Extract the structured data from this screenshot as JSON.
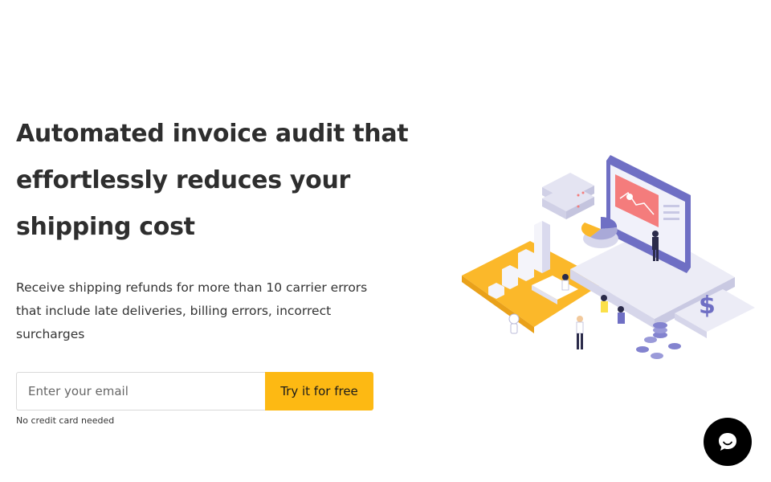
{
  "hero": {
    "title_lines": [
      "Automated invoice audit that",
      "effortlessly reduces your",
      "shipping cost"
    ],
    "subtitle_lines": [
      "Receive shipping refunds for more than 10 carrier errors",
      "that include late deliveries, billing errors, incorrect",
      "surcharges"
    ]
  },
  "signup": {
    "email_placeholder": "Enter your email",
    "button_label": "Try it for free",
    "note": "No credit card needed"
  },
  "illustration": {
    "icon": "invoice-audit-illustration"
  },
  "chat": {
    "icon": "chat-bubble-icon"
  },
  "colors": {
    "accent": "#fdb913",
    "text": "#2e2e2e",
    "illustration_purple": "#6f6fc4",
    "illustration_coral": "#f47c7c"
  }
}
